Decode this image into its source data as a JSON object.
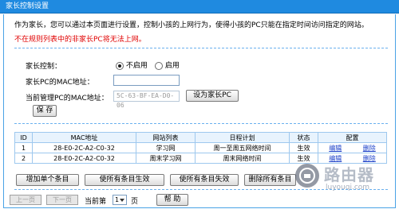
{
  "title": "家长控制设置",
  "description": "作为家长，您可以通过本页面进行设置，控制小孩的上网行为，使得小孩的PC只能在指定时间访问指定的网站。",
  "warning": "不在规则列表中的非家长PC将无法上网。",
  "form": {
    "parental_control_label": "家长控制：",
    "option_disable": "不启用",
    "option_enable": "启用",
    "selected_option": "不启用",
    "parent_mac_label": "家长PC的MAC地址：",
    "parent_mac_value": "",
    "current_mac_label": "当前管理PC的MAC地址：",
    "current_mac_value": "5C-63-BF-EA-D0-06",
    "set_parent_button": "设为家长PC",
    "save_button": "保 存"
  },
  "table": {
    "headers": [
      "ID",
      "MAC地址",
      "网站列表",
      "日程计划",
      "状态",
      "配置"
    ],
    "rows": [
      {
        "id": "1",
        "mac": "28-E0-2C-A2-C0-32",
        "site_list": "学习网",
        "schedule": "周一至周五网络时间",
        "status": "生效",
        "edit": "编辑",
        "delete": "删除"
      },
      {
        "id": "2",
        "mac": "28-E0-2C-A2-C0-32",
        "site_list": "周末学习网",
        "schedule": "周末网络时间",
        "status": "生效",
        "edit": "编辑",
        "delete": "删除"
      }
    ]
  },
  "actions": {
    "add_entry": "增加单个条目",
    "enable_all": "使所有条目生效",
    "disable_all": "使所有条目失效",
    "delete_all": "删除所有条目"
  },
  "pager": {
    "prev": "上一页",
    "next": "下一页",
    "current_label": "当前第",
    "current_page": "1",
    "page_suffix": "页",
    "help": "帮 助"
  },
  "watermark": {
    "text": "路由器",
    "sub": "luyouqi.com"
  }
}
